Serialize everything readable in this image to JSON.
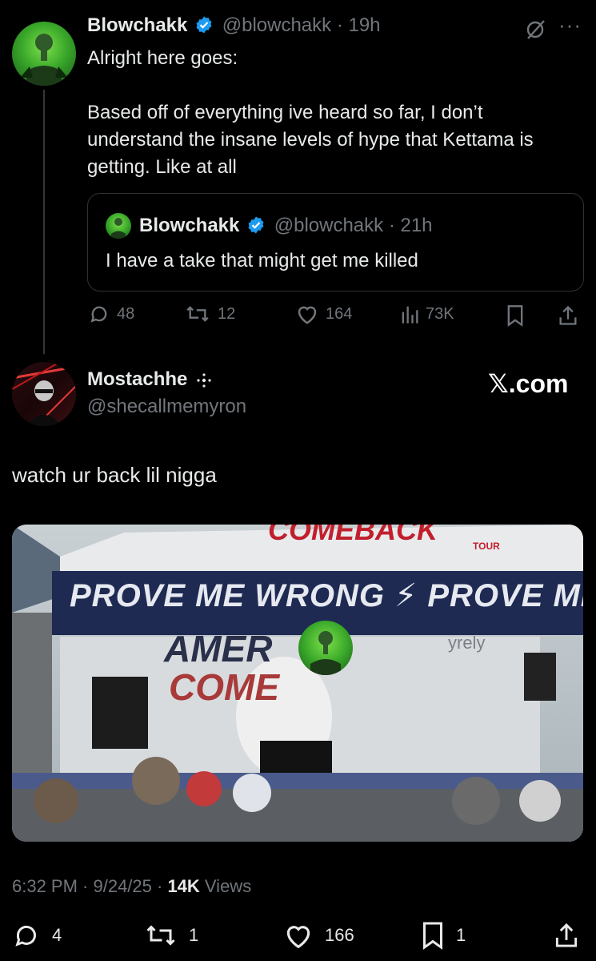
{
  "tweet1": {
    "name": "Blowchakk",
    "handle": "@blowchakk",
    "time": "19h",
    "text_line1": "Alright here goes:",
    "text_p2": "Based off of everything ive heard so far, I don’t understand the insane levels of hype that Kettama is getting. Like at all",
    "quote": {
      "name": "Blowchakk",
      "handle": "@blowchakk",
      "time": "21h",
      "text": "I have a take that might get me killed"
    },
    "actions": {
      "replies": "48",
      "reposts": "12",
      "likes": "164",
      "views": "73K"
    }
  },
  "tweet2": {
    "name": "Mostachhe",
    "handle": "@shecallmemyron",
    "text": "watch ur back lil nigga",
    "timestamp": "6:32 PM · 9/24/25 · ",
    "views_count": "14K",
    "views_label": " Views",
    "actions": {
      "replies": "4",
      "reposts": "1",
      "likes": "166",
      "bookmarks": "1"
    }
  },
  "branding": {
    "logo_text": "𝕏.com"
  },
  "media": {
    "banner_text": "PROVE ME WRONG ⚡ PROVE ME",
    "top_banner_text": "COMEBACK",
    "tour_text": "TOUR",
    "sign_text1": "AMER",
    "sign_text2": "COME",
    "sponsor_text": "yrely"
  },
  "colors": {
    "background": "#000000",
    "text": "#e7e9ea",
    "muted": "#71767b",
    "verified": "#1d9bf0",
    "border": "#2f3336"
  }
}
